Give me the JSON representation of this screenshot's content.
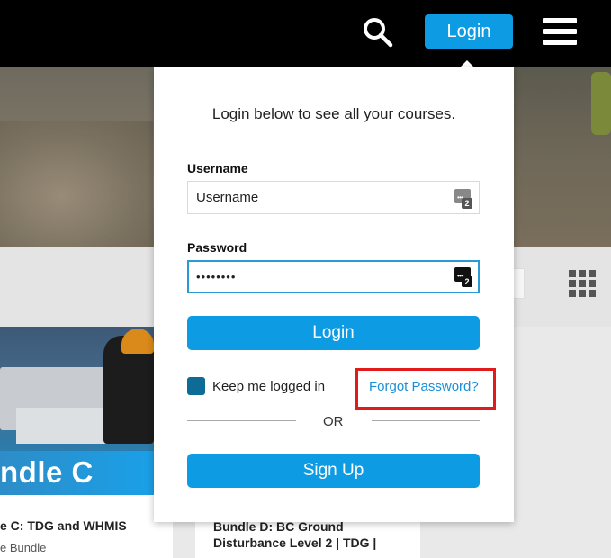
{
  "header": {
    "login_label": "Login"
  },
  "login_popover": {
    "intro": "Login below to see all your courses.",
    "username_label": "Username",
    "username_value": "Username",
    "password_label": "Password",
    "password_masked": "••••••••",
    "password_manager_badge": "2",
    "login_button": "Login",
    "keep_logged_in": "Keep me logged in",
    "keep_logged_in_checked": true,
    "forgot_password": "Forgot Password?",
    "or_divider": "OR",
    "signup_button": "Sign Up"
  },
  "cards": [
    {
      "banner": "ndle C",
      "title": "e C: TDG and WHMIS",
      "subtitle": "e Bundle"
    },
    {
      "title": "Bundle D: BC Ground Disturbance Level 2 | TDG |"
    }
  ],
  "colors": {
    "accent": "#0d9be3",
    "topbar": "#000000",
    "highlight": "#e11b1b",
    "checkbox": "#0e6b95",
    "link": "#1a8fd6"
  },
  "icons": [
    "search-icon",
    "hamburger-menu-icon",
    "grid-view-icon",
    "password-manager-icon"
  ]
}
